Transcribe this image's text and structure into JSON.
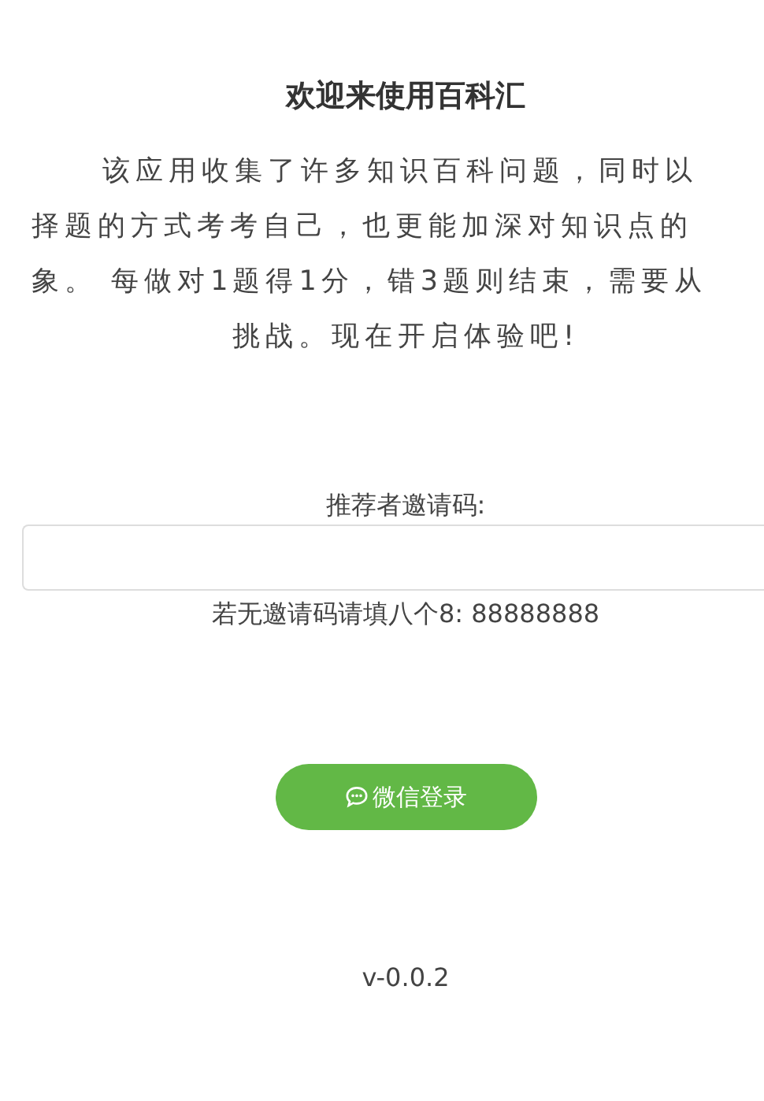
{
  "title": "欢迎来使用百科汇",
  "intro_lines": [
    "该应用收集了许多知识百科问题，同时以",
    "择题的方式考考自己，也更能加深对知识点的",
    "象。 每做对1题得1分，错3题则结束，需要从",
    "挑战。现在开启体验吧!"
  ],
  "invite_label": "推荐者邀请码:",
  "invite_hint": "若无邀请码请填八个8: 88888888",
  "login_button": "微信登录",
  "version": "v-0.0.2"
}
